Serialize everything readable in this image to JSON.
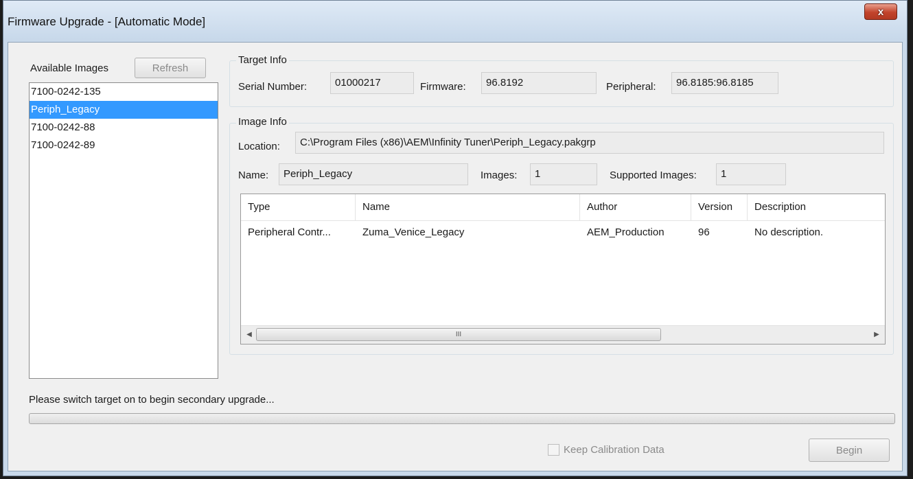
{
  "window": {
    "title": "Firmware Upgrade - [Automatic Mode]",
    "close_symbol": "x"
  },
  "available_images": {
    "label": "Available Images",
    "refresh_label": "Refresh",
    "items": [
      "7100-0242-135",
      "Periph_Legacy",
      "7100-0242-88",
      "7100-0242-89"
    ],
    "selected_index": 1
  },
  "target_info": {
    "title": "Target Info",
    "serial_label": "Serial Number:",
    "serial_value": "01000217",
    "firmware_label": "Firmware:",
    "firmware_value": "96.8192",
    "peripheral_label": "Peripheral:",
    "peripheral_value": "96.8185:96.8185"
  },
  "image_info": {
    "title": "Image Info",
    "location_label": "Location:",
    "location_value": "C:\\Program Files (x86)\\AEM\\Infinity Tuner\\Periph_Legacy.pakgrp",
    "name_label": "Name:",
    "name_value": "Periph_Legacy",
    "images_label": "Images:",
    "images_value": "1",
    "supported_label": "Supported Images:",
    "supported_value": "1"
  },
  "table": {
    "columns": [
      "Type",
      "Name",
      "Author",
      "Version",
      "Description"
    ],
    "rows": [
      [
        "Peripheral Contr...",
        "Zuma_Venice_Legacy",
        "AEM_Production",
        "96",
        "No description."
      ]
    ],
    "scroll_grip": "III"
  },
  "status": {
    "text": "Please switch target on to begin secondary upgrade...",
    "progress": 0
  },
  "footer": {
    "keep_calibration_label": "Keep Calibration Data",
    "keep_calibration_checked": false,
    "begin_label": "Begin"
  },
  "colors": {
    "selection": "#3399ff",
    "close_button": "#c2432b",
    "title_bar": "#c9d9ea"
  }
}
